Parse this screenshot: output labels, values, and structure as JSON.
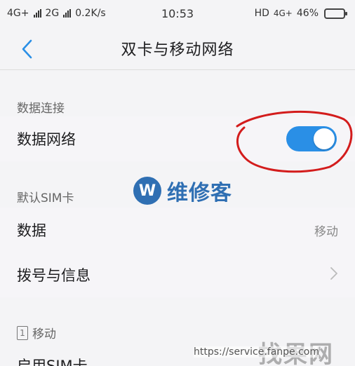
{
  "status_bar": {
    "sim1_network": "4G+",
    "sim2_network": "2G",
    "speed": "0.2K/s",
    "time": "10:53",
    "hd": "HD",
    "network_right": "4G+",
    "battery": "46%",
    "battery_level": 0.46
  },
  "header": {
    "title": "双卡与移动网络"
  },
  "sections": {
    "data_connection": {
      "header": "数据连接",
      "data_network_label": "数据网络",
      "data_network_enabled": true
    },
    "default_sim": {
      "header": "默认SIM卡",
      "data_label": "数据",
      "data_value": "移动",
      "dial_label": "拨号与信息"
    },
    "sim1": {
      "header": "移动",
      "sim_number": "1",
      "enable_label": "启用SIM卡"
    }
  },
  "watermark": {
    "badge": "W",
    "text": "维修客",
    "bottom": "找果网",
    "url": "https://service.fanpe.com"
  },
  "colors": {
    "toggle_on": "#2a8fe6",
    "accent_back": "#2a8fe6",
    "annotation_red": "#d31c1c"
  }
}
